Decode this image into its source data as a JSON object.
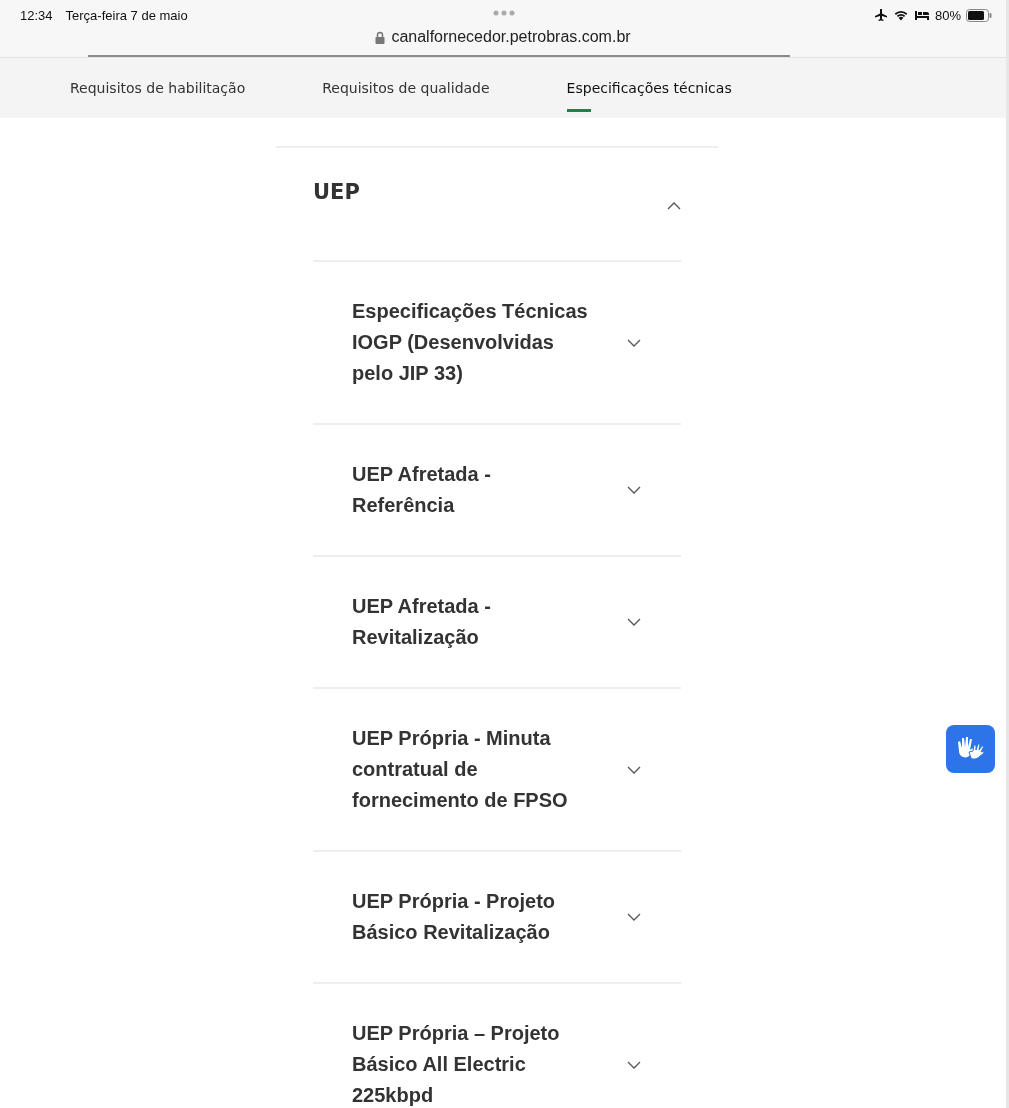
{
  "status_bar": {
    "time": "12:34",
    "date": "Terça-feira 7 de maio",
    "battery": "80%"
  },
  "address_bar": {
    "url": "canalfornecedor.petrobras.com.br"
  },
  "tabs": [
    {
      "label": "Requisitos de habilitação",
      "selected": false
    },
    {
      "label": "Requisitos de qualidade",
      "selected": false
    },
    {
      "label": "Especificações técnicas",
      "selected": true
    }
  ],
  "accordion": {
    "title": "UEP",
    "expanded": true,
    "children": [
      {
        "title": "Especificações Técnicas IOGP (Desenvolvidas pelo JIP 33)",
        "expanded": false
      },
      {
        "title": "UEP Afretada - Referência",
        "expanded": false
      },
      {
        "title": "UEP Afretada - Revitalização",
        "expanded": false
      },
      {
        "title": "UEP Própria - Minuta contratual de fornecimento de FPSO",
        "expanded": false
      },
      {
        "title": "UEP Própria - Projeto Básico Revitalização",
        "expanded": false
      },
      {
        "title": "UEP Própria – Projeto Básico All Electric 225kbpd",
        "expanded": false
      }
    ]
  }
}
